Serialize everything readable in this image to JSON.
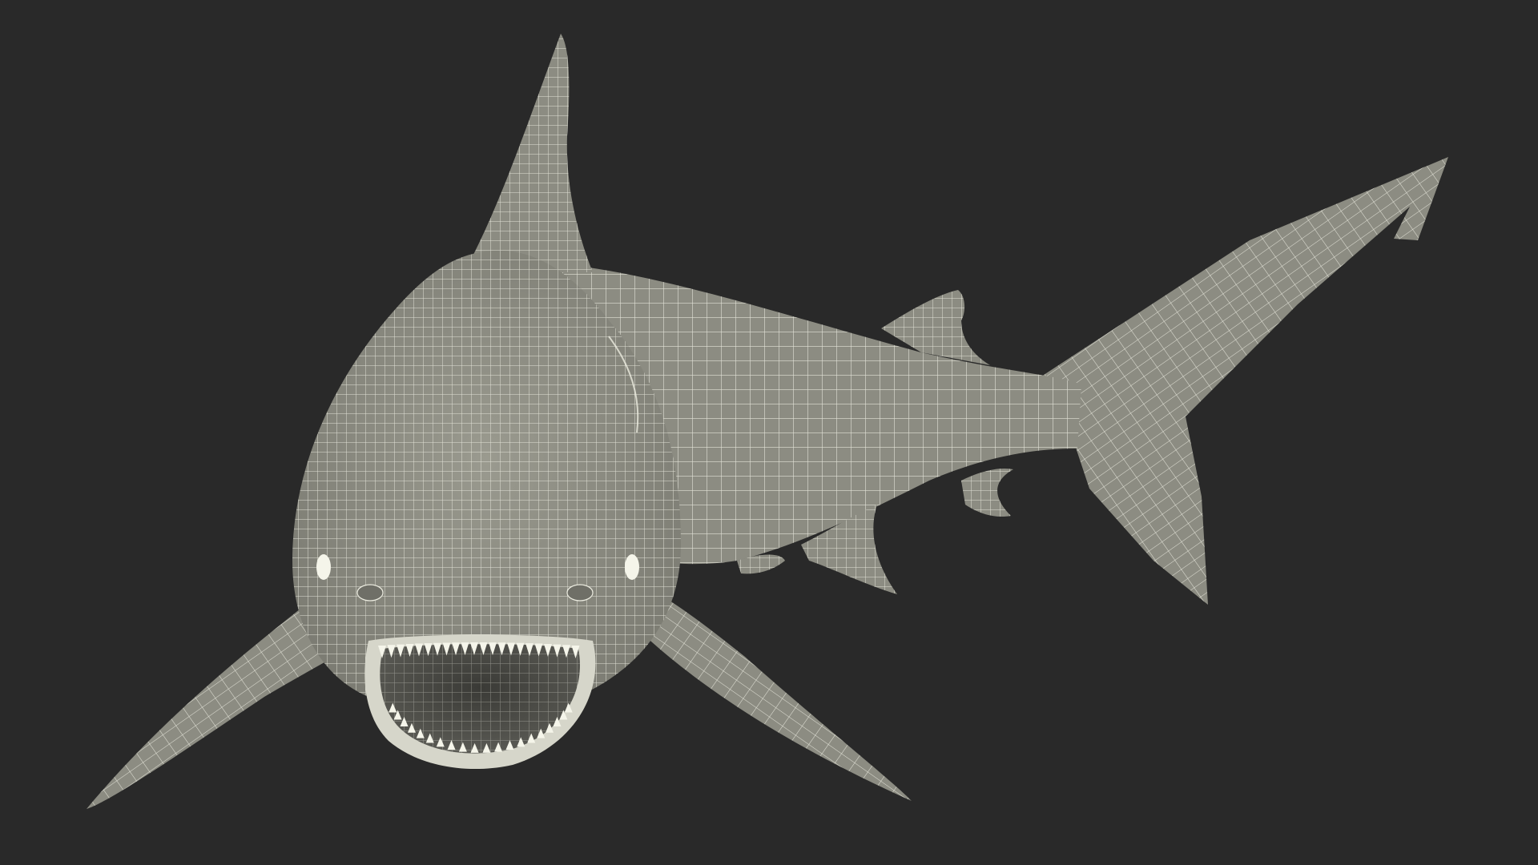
{
  "scene": {
    "subject": "shark-wireframe-model",
    "colors": {
      "background": "#292929",
      "surface": "#8c8c82",
      "surface_dark": "#6f6f67",
      "wire": "#ecece0",
      "mouth_interior": "#4a4a45"
    }
  }
}
